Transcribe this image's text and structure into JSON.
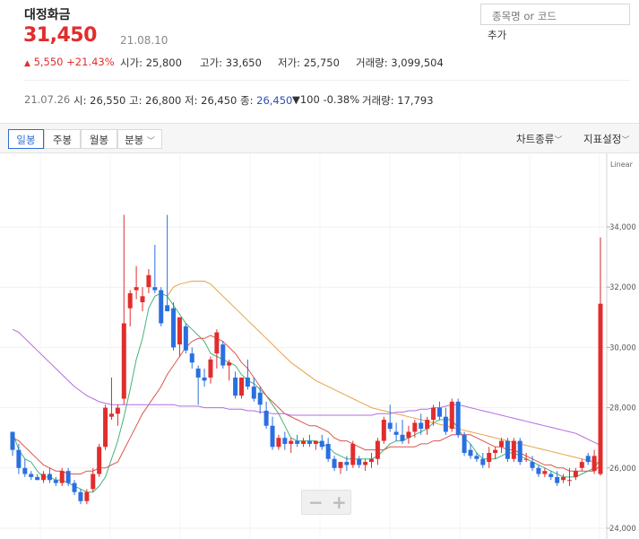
{
  "stock": {
    "name": "대정화금",
    "price": "31,450",
    "date": "21.08.10",
    "change_arrow": "▲",
    "change": "5,550",
    "change_pct": "+21.43%",
    "open_label": "시가",
    "open": "25,800",
    "high_label": "고가",
    "high": "33,650",
    "low_label": "저가",
    "low": "25,750",
    "volume_label": "거래량",
    "volume": "3,099,504"
  },
  "search": {
    "placeholder": "종목명 or 코드",
    "add_label": "추가"
  },
  "day_detail": {
    "date": "21.07.26",
    "open_label": "시",
    "open": "26,550",
    "high_label": "고",
    "high": "26,800",
    "low_label": "저",
    "low": "26,450",
    "close_label": "종",
    "close": "26,450",
    "change_arrow": "▼",
    "change": "100",
    "change_pct": "-0.38%",
    "volume_label": "거래량",
    "volume": "17,793"
  },
  "toolbar": {
    "tabs": [
      "일봉",
      "주봉",
      "월봉",
      "분봉"
    ],
    "chart_type": "차트종류",
    "indicator": "지표설정"
  },
  "colors": {
    "up": "#e12d2d",
    "down": "#2a6fe0",
    "ma5": "#47b27a",
    "ma20": "#d9574b",
    "ma60": "#e8a24a",
    "ma120": "#b36ce0"
  },
  "chart_data": {
    "type": "candlestick",
    "scale_label": "Linear",
    "y_ticks": [
      "34,000",
      "32,000",
      "30,000",
      "28,000",
      "26,000",
      "24,000"
    ],
    "ylim": [
      24000,
      36000
    ],
    "candles": [
      [
        27200,
        27200,
        26400,
        26600
      ],
      [
        26600,
        26800,
        25800,
        26000
      ],
      [
        26000,
        26300,
        25700,
        25800
      ],
      [
        25800,
        25900,
        25600,
        25700
      ],
      [
        25700,
        25800,
        25600,
        25600
      ],
      [
        25600,
        25900,
        25500,
        25800
      ],
      [
        25800,
        26000,
        25500,
        25600
      ],
      [
        25600,
        25700,
        25400,
        25500
      ],
      [
        25500,
        26000,
        25400,
        25900
      ],
      [
        25900,
        26000,
        25400,
        25500
      ],
      [
        25500,
        25600,
        25100,
        25200
      ],
      [
        25200,
        25300,
        24800,
        24900
      ],
      [
        24900,
        25300,
        24800,
        25200
      ],
      [
        25300,
        26000,
        25200,
        25800
      ],
      [
        25800,
        26800,
        25700,
        26700
      ],
      [
        26700,
        28100,
        26600,
        28000
      ],
      [
        27700,
        29000,
        27600,
        27800
      ],
      [
        27800,
        28100,
        27400,
        28000
      ],
      [
        28300,
        34400,
        28100,
        30800
      ],
      [
        31300,
        31900,
        30700,
        31800
      ],
      [
        31900,
        32700,
        31600,
        32000
      ],
      [
        31500,
        32000,
        31200,
        31700
      ],
      [
        32000,
        32600,
        31800,
        32400
      ],
      [
        32000,
        33400,
        31800,
        31900
      ],
      [
        31900,
        32000,
        30700,
        30800
      ],
      [
        31400,
        34400,
        31200,
        31200
      ],
      [
        31300,
        31500,
        29900,
        30000
      ],
      [
        30100,
        31000,
        29700,
        31000
      ],
      [
        30700,
        30800,
        29800,
        29900
      ],
      [
        29800,
        30000,
        29300,
        29500
      ],
      [
        29300,
        29400,
        28100,
        29000
      ],
      [
        29000,
        29300,
        28700,
        28900
      ],
      [
        29000,
        29700,
        28800,
        29600
      ],
      [
        29800,
        30600,
        29300,
        30500
      ],
      [
        30100,
        30200,
        29300,
        29400
      ],
      [
        29400,
        29600,
        28900,
        29500
      ],
      [
        29000,
        29200,
        28300,
        28400
      ],
      [
        28400,
        29000,
        28300,
        29000
      ],
      [
        29000,
        29600,
        28600,
        28700
      ],
      [
        28700,
        29000,
        28200,
        28300
      ],
      [
        28500,
        28700,
        27800,
        28100
      ],
      [
        27900,
        28200,
        27300,
        27400
      ],
      [
        27400,
        27700,
        26600,
        26700
      ],
      [
        26700,
        27100,
        26600,
        27000
      ],
      [
        27000,
        27200,
        26600,
        26800
      ],
      [
        26800,
        27000,
        26500,
        26900
      ],
      [
        26900,
        27100,
        26700,
        26800
      ],
      [
        26800,
        27000,
        26700,
        26900
      ],
      [
        26900,
        27100,
        26700,
        26800
      ],
      [
        26800,
        26900,
        26600,
        26900
      ],
      [
        26900,
        27100,
        26600,
        26700
      ],
      [
        26800,
        27000,
        26200,
        26300
      ],
      [
        26300,
        26400,
        25900,
        26000
      ],
      [
        26000,
        26200,
        25800,
        26200
      ],
      [
        26200,
        26400,
        25900,
        26100
      ],
      [
        26100,
        26900,
        26000,
        26800
      ],
      [
        26300,
        26400,
        26000,
        26100
      ],
      [
        26100,
        26300,
        25900,
        26200
      ],
      [
        26200,
        26500,
        26000,
        26300
      ],
      [
        26300,
        27000,
        26100,
        26900
      ],
      [
        26900,
        27700,
        26800,
        27600
      ],
      [
        27500,
        28100,
        27200,
        27300
      ],
      [
        27200,
        27500,
        26900,
        27100
      ],
      [
        27100,
        27600,
        26800,
        26900
      ],
      [
        27000,
        27400,
        26800,
        27200
      ],
      [
        27200,
        27600,
        27000,
        27500
      ],
      [
        27500,
        27800,
        27100,
        27300
      ],
      [
        27300,
        27700,
        27100,
        27600
      ],
      [
        27600,
        28100,
        27400,
        28000
      ],
      [
        28000,
        28200,
        27600,
        27700
      ],
      [
        27700,
        28000,
        27100,
        27200
      ],
      [
        27300,
        28300,
        27200,
        28200
      ],
      [
        28200,
        28300,
        27000,
        27100
      ],
      [
        27100,
        27200,
        26400,
        26500
      ],
      [
        26600,
        26800,
        26300,
        26400
      ],
      [
        26400,
        26500,
        26200,
        26300
      ],
      [
        26300,
        26500,
        26000,
        26100
      ],
      [
        26200,
        26700,
        26000,
        26500
      ],
      [
        26500,
        26700,
        26300,
        26600
      ],
      [
        26700,
        27000,
        26500,
        26900
      ],
      [
        26900,
        27000,
        26200,
        26300
      ],
      [
        26300,
        27000,
        26200,
        26900
      ],
      [
        26900,
        27000,
        26100,
        26200
      ],
      [
        26300,
        26500,
        26200,
        26300
      ],
      [
        26200,
        26400,
        25900,
        26000
      ],
      [
        26000,
        26100,
        25700,
        25800
      ],
      [
        25800,
        26000,
        25700,
        25900
      ],
      [
        25800,
        25900,
        25600,
        25700
      ],
      [
        25700,
        25900,
        25400,
        25500
      ],
      [
        25600,
        25800,
        25500,
        25700
      ],
      [
        25600,
        26000,
        25400,
        25600
      ],
      [
        25700,
        26000,
        25600,
        25900
      ],
      [
        26000,
        26300,
        25900,
        26200
      ],
      [
        26400,
        26500,
        26100,
        26200
      ],
      [
        25900,
        26600,
        25800,
        26400
      ],
      [
        25800,
        33650,
        25750,
        31450
      ]
    ],
    "ma_series": [
      {
        "values": [
          27200,
          26600,
          26300,
          26200,
          25900,
          25700,
          25700,
          25600,
          25600,
          25500,
          25400,
          25300,
          25200,
          25200,
          25400,
          25700,
          26300,
          26900,
          27700,
          28600,
          29600,
          30300,
          31300,
          31700,
          31800,
          31700,
          31400,
          31100,
          30800,
          30600,
          30400,
          30200,
          29800,
          29700,
          29600,
          29500,
          29400,
          29100,
          28900,
          28800,
          28600,
          28400,
          28100,
          27800,
          27400,
          27000,
          26900,
          26900,
          26900,
          26900,
          26800,
          26700,
          26500,
          26400,
          26300,
          26300,
          26300,
          26300,
          26300,
          26400,
          26600,
          26800,
          26900,
          26900,
          27000,
          27100,
          27200,
          27300,
          27500,
          27600,
          27600,
          27600,
          27300,
          27000,
          26800,
          26500,
          26300,
          26300,
          26300,
          26400,
          26500,
          26500,
          26400,
          26300,
          26200,
          26100,
          26000,
          25900,
          25800,
          25700,
          25700,
          25700,
          25800,
          25900,
          26000,
          26300
        ]
      },
      {
        "values": [
          27000,
          26900,
          26700,
          26500,
          26300,
          26100,
          26000,
          25900,
          25900,
          25800,
          25800,
          25800,
          25900,
          25900,
          26000,
          26000,
          26100,
          26200,
          26600,
          27000,
          27400,
          27800,
          28100,
          28400,
          28700,
          29100,
          29400,
          29700,
          30000,
          30200,
          30300,
          30300,
          30400,
          30300,
          30200,
          30000,
          29800,
          29500,
          29300,
          29000,
          28700,
          28400,
          28200,
          28000,
          27800,
          27700,
          27600,
          27500,
          27400,
          27400,
          27300,
          27200,
          27000,
          26900,
          26900,
          26800,
          26700,
          26600,
          26600,
          26600,
          26600,
          26700,
          26700,
          26700,
          26700,
          26700,
          26800,
          26800,
          26900,
          26900,
          27000,
          27100,
          27100,
          27100,
          27100,
          27000,
          26900,
          26800,
          26700,
          26700,
          26600,
          26600,
          26500,
          26400,
          26300,
          26200,
          26100,
          26100,
          26000,
          26000,
          25900,
          25900,
          25900,
          25900,
          25900,
          26100
        ]
      },
      {
        "values": [
          null,
          null,
          null,
          null,
          null,
          null,
          null,
          null,
          null,
          null,
          null,
          null,
          null,
          null,
          null,
          null,
          null,
          null,
          null,
          null,
          null,
          null,
          null,
          null,
          null,
          31700,
          32000,
          32100,
          32150,
          32200,
          32200,
          32200,
          32100,
          31900,
          31700,
          31500,
          31300,
          31100,
          30900,
          30700,
          30500,
          30300,
          30100,
          29900,
          29700,
          29500,
          29350,
          29200,
          29050,
          28900,
          28800,
          28700,
          28600,
          28500,
          28400,
          28300,
          28200,
          28100,
          28000,
          27950,
          27900,
          27850,
          27800,
          27750,
          27700,
          27650,
          27600,
          27550,
          27500,
          27450,
          27400,
          27350,
          27300,
          27250,
          27200,
          27150,
          27100,
          27050,
          27000,
          26950,
          26900,
          26850,
          26800,
          26750,
          26700,
          26650,
          26600,
          26550,
          26500,
          26450,
          26400,
          26350,
          26300,
          26250,
          26200,
          26150
        ]
      },
      {
        "values": [
          30600,
          30500,
          30300,
          30100,
          29900,
          29700,
          29500,
          29300,
          29100,
          28900,
          28700,
          28550,
          28400,
          28300,
          28200,
          28150,
          28100,
          28100,
          28100,
          28100,
          28100,
          28100,
          28100,
          28100,
          28100,
          28100,
          28100,
          28050,
          28050,
          28050,
          28050,
          28000,
          28000,
          28000,
          28000,
          27950,
          27950,
          27950,
          27900,
          27900,
          27850,
          27850,
          27800,
          27800,
          27800,
          27750,
          27750,
          27750,
          27750,
          27750,
          27750,
          27750,
          27750,
          27750,
          27750,
          27750,
          27750,
          27750,
          27750,
          27800,
          27800,
          27800,
          27850,
          27850,
          27900,
          27900,
          27950,
          27950,
          28000,
          28000,
          28050,
          28100,
          28100,
          28050,
          28000,
          27950,
          27900,
          27850,
          27800,
          27750,
          27700,
          27650,
          27600,
          27550,
          27500,
          27450,
          27400,
          27350,
          27300,
          27250,
          27200,
          27150,
          27050,
          26950,
          26850,
          26750
        ]
      }
    ]
  }
}
